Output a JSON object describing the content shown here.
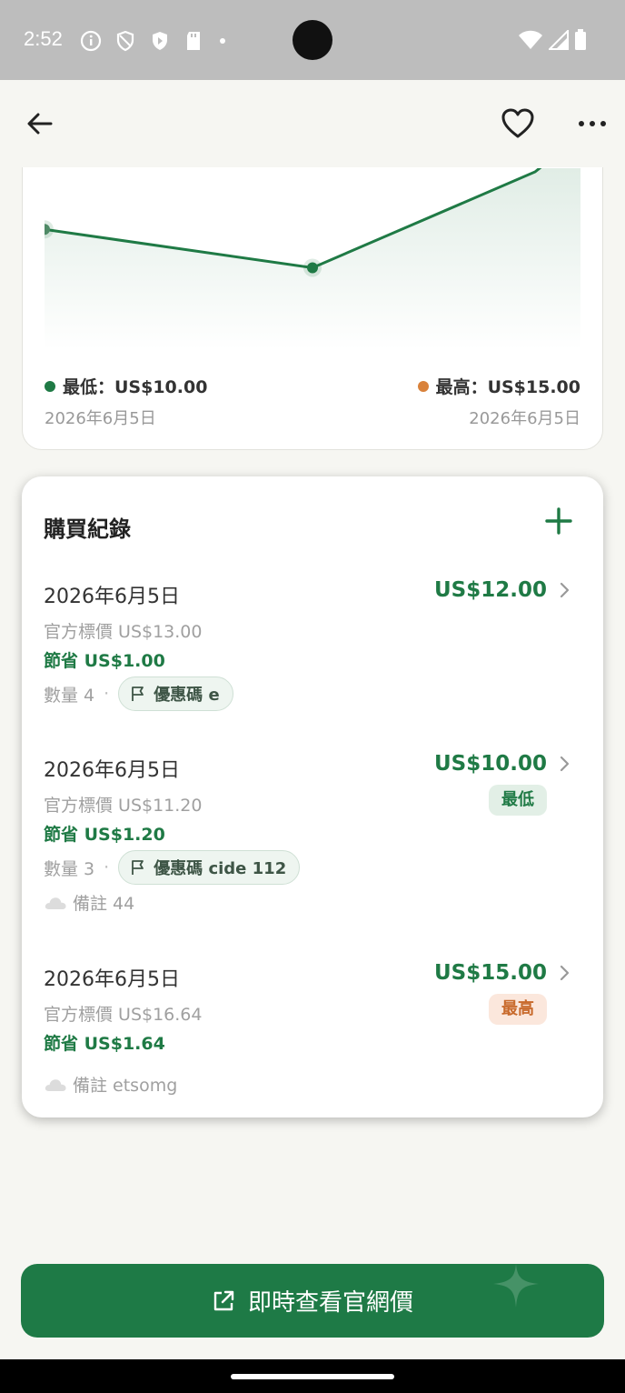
{
  "status_bar": {
    "time": "2:52"
  },
  "chart_data": {
    "type": "line",
    "title": "",
    "xlabel": "",
    "ylabel": "",
    "series": [
      {
        "values": [
          12.0,
          10.0,
          15.0
        ]
      }
    ],
    "ylim": [
      9.5,
      15.0
    ],
    "grid": false,
    "color": "#1f7a45",
    "min": {
      "label": "最低：US$10.00",
      "date": "2026年6月5日",
      "color": "#1f7a45"
    },
    "max": {
      "label": "最高：US$15.00",
      "date": "2026年6月5日",
      "color": "#d9823b"
    }
  },
  "purchase_history": {
    "title": "購買紀錄",
    "records": [
      {
        "date": "2026年6月5日",
        "price": "US$12.00",
        "official": "官方標價 US$13.00",
        "saving": "節省 US$1.00",
        "quantity": "數量 4",
        "coupon": "優惠碼 e"
      },
      {
        "date": "2026年6月5日",
        "price": "US$10.00",
        "badge": "最低",
        "official": "官方標價 US$11.20",
        "saving": "節省 US$1.20",
        "quantity": "數量 3",
        "coupon": "優惠碼 cide 112",
        "note": "備註 44"
      },
      {
        "date": "2026年6月5日",
        "price": "US$15.00",
        "badge": "最高",
        "official": "官方標價 US$16.64",
        "saving": "節省 US$1.64",
        "note": "備註 etsomg"
      }
    ]
  },
  "cta": {
    "label": "即時查看官網價"
  },
  "colors": {
    "accent": "#1e7a46",
    "high": "#d9823b"
  }
}
